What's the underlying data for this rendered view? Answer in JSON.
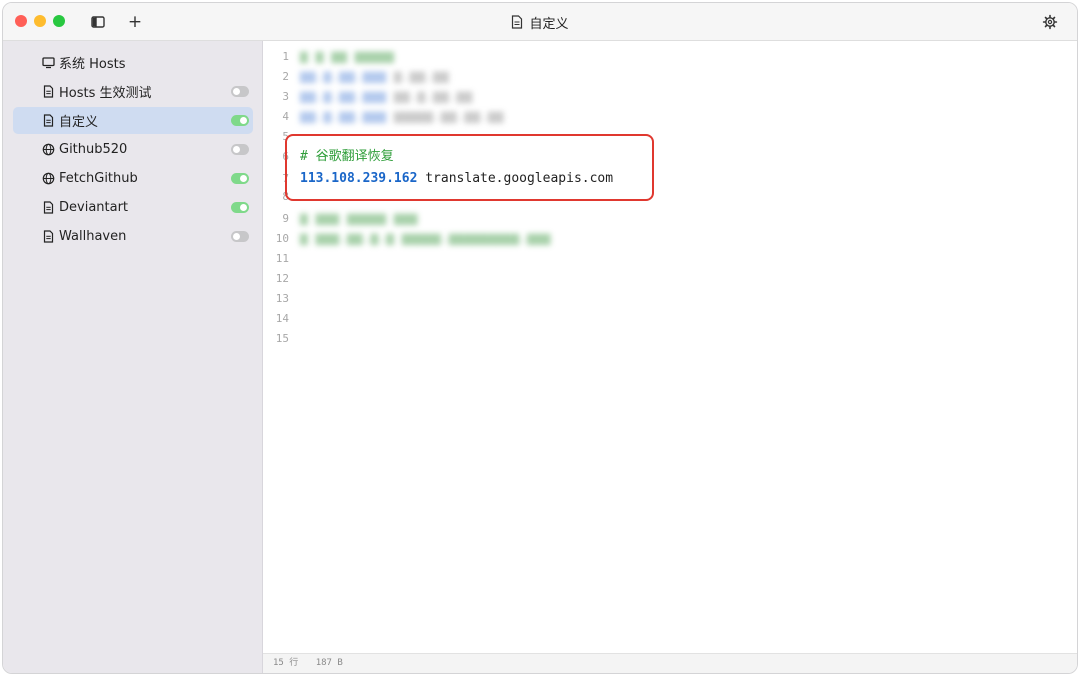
{
  "window": {
    "title": "自定义"
  },
  "toolbar": {
    "add_label": "+"
  },
  "sidebar": {
    "items": [
      {
        "label": "系统 Hosts",
        "icon": "monitor-icon",
        "toggle": null,
        "selected": false
      },
      {
        "label": "Hosts 生效测试",
        "icon": "document-icon",
        "toggle": "off",
        "selected": false
      },
      {
        "label": "自定义",
        "icon": "document-icon",
        "toggle": "on",
        "selected": true
      },
      {
        "label": "Github520",
        "icon": "globe-icon",
        "toggle": "off",
        "selected": false
      },
      {
        "label": "FetchGithub",
        "icon": "globe-icon",
        "toggle": "on",
        "selected": false
      },
      {
        "label": "Deviantart",
        "icon": "document-icon",
        "toggle": "on",
        "selected": false
      },
      {
        "label": "Wallhaven",
        "icon": "document-icon",
        "toggle": "off",
        "selected": false
      }
    ]
  },
  "editor": {
    "line_numbers": [
      "1",
      "2",
      "3",
      "4",
      "5",
      "6",
      "7",
      "8",
      "9",
      "10",
      "11",
      "12",
      "13",
      "14",
      "15"
    ],
    "line6_comment": "# 谷歌翻译恢复",
    "line7_ip": "113.108.239.162",
    "line7_host": " translate.googleapis.com"
  },
  "status": {
    "lines": "15 行",
    "size": "187 B"
  },
  "colors": {
    "comment": "#2f9e3a",
    "ip": "#1a66c8",
    "highlight_border": "#e0382f",
    "selected_row": "#cfdcf1",
    "toggle_on": "#7fd98a",
    "toggle_off": "#c7c7c9"
  }
}
